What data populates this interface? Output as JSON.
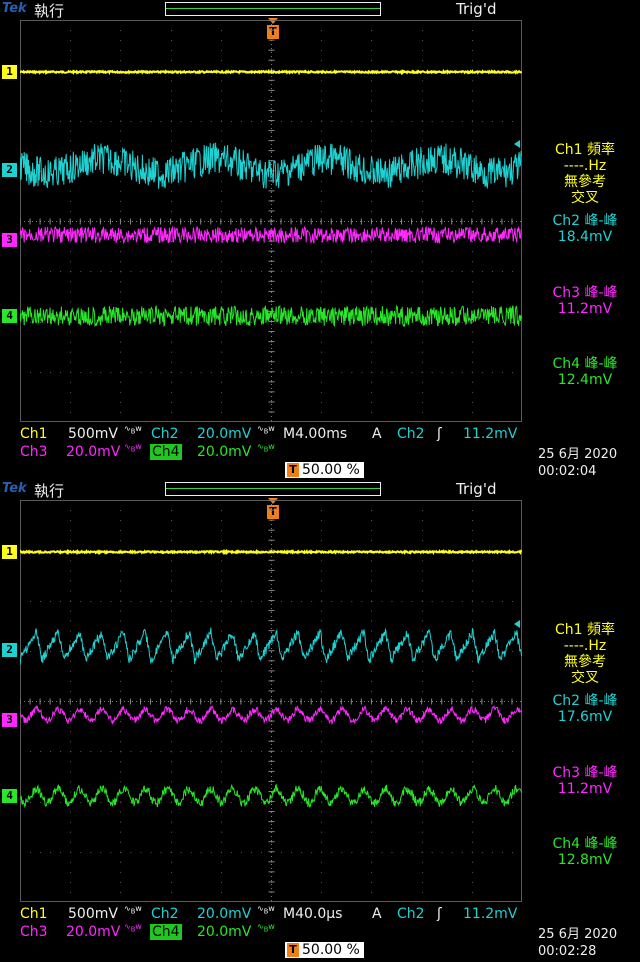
{
  "colors": {
    "ch1": "#ffff1e",
    "ch2": "#1ed2d2",
    "ch3": "#ff28ff",
    "ch4": "#28e628",
    "trigger": "#f07f1a",
    "grid": "#5a5a5a",
    "text": "#eeeeee"
  },
  "screens": [
    {
      "logo": "Tek",
      "run_state": "執行",
      "trig_status": "Trig'd",
      "trigger_marker": "T",
      "channel_markers": [
        "1",
        "2",
        "3",
        "4"
      ],
      "measurements": {
        "ch1": [
          "Ch1 頻率",
          "----.Hz",
          "無參考",
          "交叉"
        ],
        "ch2": [
          "Ch2 峰-峰",
          "18.4mV"
        ],
        "ch3": [
          "Ch3 峰-峰",
          "11.2mV"
        ],
        "ch4": [
          "Ch4 峰-峰",
          "12.4mV"
        ]
      },
      "footer": {
        "ch1_label": "Ch1",
        "ch1_scale": "500mV",
        "ch2_label": "Ch2",
        "ch2_scale": "20.0mV",
        "ch3_label": "Ch3",
        "ch3_scale": "20.0mV",
        "ch4_label": "Ch4",
        "ch4_scale": "20.0mV",
        "timebase": "M4.00ms",
        "acq_mode": "A",
        "trig_source": "Ch2",
        "trig_slope": "ʃ",
        "trig_level": "11.2mV",
        "trig_position": "50.00 %",
        "date": "25 6月  2020",
        "time": "00:02:04"
      },
      "waveforms": {
        "ch2_style": "noisy-slow",
        "ch3_style": "noise",
        "ch4_style": "noise"
      }
    },
    {
      "logo": "Tek",
      "run_state": "執行",
      "trig_status": "Trig'd",
      "trigger_marker": "T",
      "channel_markers": [
        "1",
        "2",
        "3",
        "4"
      ],
      "measurements": {
        "ch1": [
          "Ch1 頻率",
          "----.Hz",
          "無參考",
          "交叉"
        ],
        "ch2": [
          "Ch2 峰-峰",
          "17.6mV"
        ],
        "ch3": [
          "Ch3 峰-峰",
          "11.2mV"
        ],
        "ch4": [
          "Ch4 峰-峰",
          "12.8mV"
        ]
      },
      "footer": {
        "ch1_label": "Ch1",
        "ch1_scale": "500mV",
        "ch2_label": "Ch2",
        "ch2_scale": "20.0mV",
        "ch3_label": "Ch3",
        "ch3_scale": "20.0mV",
        "ch4_label": "Ch4",
        "ch4_scale": "20.0mV",
        "timebase": "M40.0µs",
        "acq_mode": "A",
        "trig_source": "Ch2",
        "trig_slope": "ʃ",
        "trig_level": "11.2mV",
        "trig_position": "50.00 %",
        "date": "25 6月  2020",
        "time": "00:02:28"
      },
      "waveforms": {
        "ch2_style": "sawtooth",
        "ch3_style": "ripple",
        "ch4_style": "ripple"
      }
    }
  ]
}
